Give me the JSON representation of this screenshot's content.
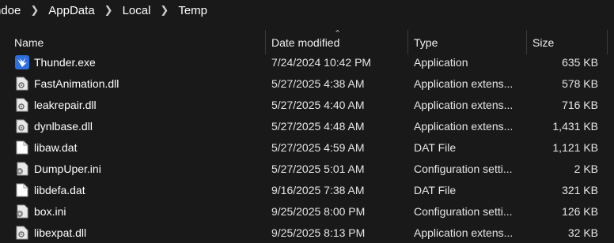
{
  "breadcrumb": [
    "ndoe",
    "AppData",
    "Local",
    "Temp"
  ],
  "columns": {
    "name": "Name",
    "date": "Date modified",
    "type": "Type",
    "size": "Size"
  },
  "files": [
    {
      "name": "Thunder.exe",
      "date": "7/24/2024 10:42 PM",
      "type": "Application",
      "size": "635 KB",
      "icon": "thunder-app-icon"
    },
    {
      "name": "FastAnimation.dll",
      "date": "5/27/2025 4:38 AM",
      "type": "Application extens...",
      "size": "578 KB",
      "icon": "dll-file-icon"
    },
    {
      "name": "leakrepair.dll",
      "date": "5/27/2025 4:40 AM",
      "type": "Application extens...",
      "size": "716 KB",
      "icon": "dll-file-icon"
    },
    {
      "name": "dynlbase.dll",
      "date": "5/27/2025 4:48 AM",
      "type": "Application extens...",
      "size": "1,431 KB",
      "icon": "dll-file-icon"
    },
    {
      "name": "libaw.dat",
      "date": "5/27/2025 4:59 AM",
      "type": "DAT File",
      "size": "1,121 KB",
      "icon": "dat-file-icon"
    },
    {
      "name": "DumpUper.ini",
      "date": "5/27/2025 5:01 AM",
      "type": "Configuration setti...",
      "size": "2 KB",
      "icon": "ini-file-icon"
    },
    {
      "name": "libdefa.dat",
      "date": "9/16/2025 7:38 AM",
      "type": "DAT File",
      "size": "321 KB",
      "icon": "dat-file-icon"
    },
    {
      "name": "box.ini",
      "date": "9/25/2025 8:00 PM",
      "type": "Configuration setti...",
      "size": "126 KB",
      "icon": "ini-file-icon"
    },
    {
      "name": "libexpat.dll",
      "date": "9/25/2025 8:13 PM",
      "type": "Application extens...",
      "size": "32 KB",
      "icon": "dll-file-icon"
    }
  ]
}
